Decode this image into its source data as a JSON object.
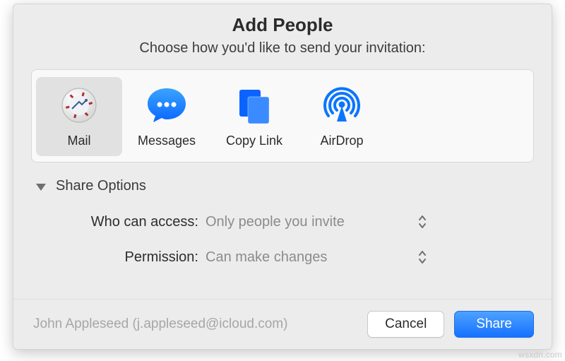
{
  "dialog": {
    "title": "Add People",
    "subtitle": "Choose how you'd like to send your invitation:"
  },
  "methods": [
    {
      "id": "mail",
      "label": "Mail",
      "selected": true
    },
    {
      "id": "messages",
      "label": "Messages",
      "selected": false
    },
    {
      "id": "copylink",
      "label": "Copy Link",
      "selected": false
    },
    {
      "id": "airdrop",
      "label": "AirDrop",
      "selected": false
    }
  ],
  "share_options": {
    "heading": "Share Options",
    "access": {
      "label": "Who can access:",
      "value": "Only people you invite"
    },
    "permission": {
      "label": "Permission:",
      "value": "Can make changes"
    }
  },
  "footer": {
    "identity": "John Appleseed (j.appleseed@icloud.com)",
    "cancel": "Cancel",
    "share": "Share"
  },
  "watermark": "wsxdn.com"
}
